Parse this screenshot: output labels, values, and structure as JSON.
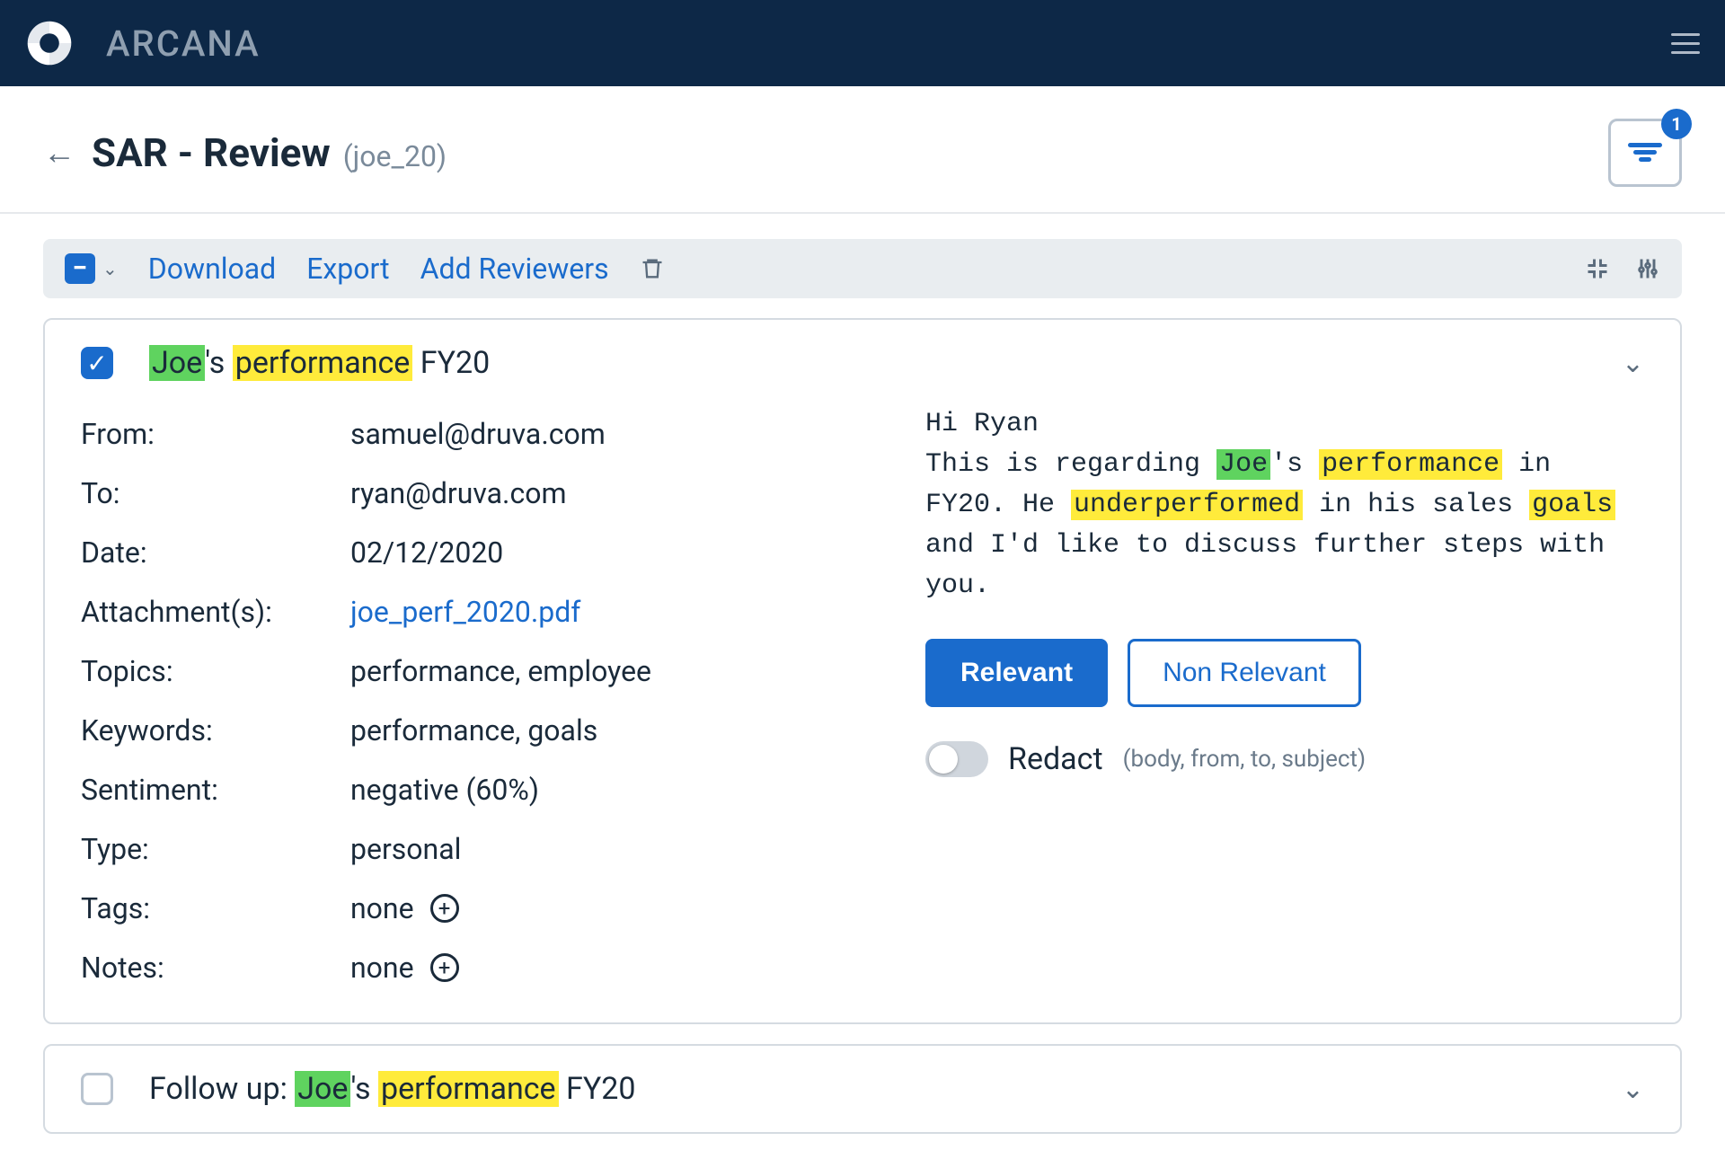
{
  "brand": "ARCANA",
  "header": {
    "title": "SAR - Review",
    "subtitle": "(joe_20)",
    "filter_badge": "1"
  },
  "toolbar": {
    "download": "Download",
    "export": "Export",
    "add_reviewers": "Add Reviewers"
  },
  "item1": {
    "title_pre": "",
    "title_hl1": "Joe",
    "title_mid1": "'s ",
    "title_hl2": "performance",
    "title_post": " FY20",
    "meta": {
      "from_label": "From:",
      "from_value": "samuel@druva.com",
      "to_label": "To:",
      "to_value": "ryan@druva.com",
      "date_label": "Date:",
      "date_value": "02/12/2020",
      "attach_label": "Attachment(s):",
      "attach_value": "joe_perf_2020.pdf",
      "topics_label": "Topics:",
      "topics_value": "performance, employee",
      "keywords_label": "Keywords:",
      "keywords_value": "performance, goals",
      "sentiment_label": "Sentiment:",
      "sentiment_value": "negative (60%)",
      "type_label": "Type:",
      "type_value": "personal",
      "tags_label": "Tags:",
      "tags_value": "none",
      "notes_label": "Notes:",
      "notes_value": "none"
    },
    "body": {
      "line1": "Hi Ryan",
      "l2_a": "This is regarding ",
      "l2_hl1": "Joe",
      "l2_b": "'s ",
      "l2_hl2": "performance",
      "l2_c": " in FY20. He ",
      "l2_hl3": "underperformed",
      "l2_d": " in his sales ",
      "l2_hl4": "goals",
      "l2_e": " and I'd like to discuss further steps with you."
    },
    "actions": {
      "relevant": "Relevant",
      "non_relevant": "Non Relevant",
      "redact": "Redact",
      "redact_hint": "(body, from, to, subject)"
    }
  },
  "item2": {
    "title_pre": "Follow up: ",
    "title_hl1": "Joe",
    "title_mid1": "'s ",
    "title_hl2": "performance",
    "title_post": " FY20"
  }
}
